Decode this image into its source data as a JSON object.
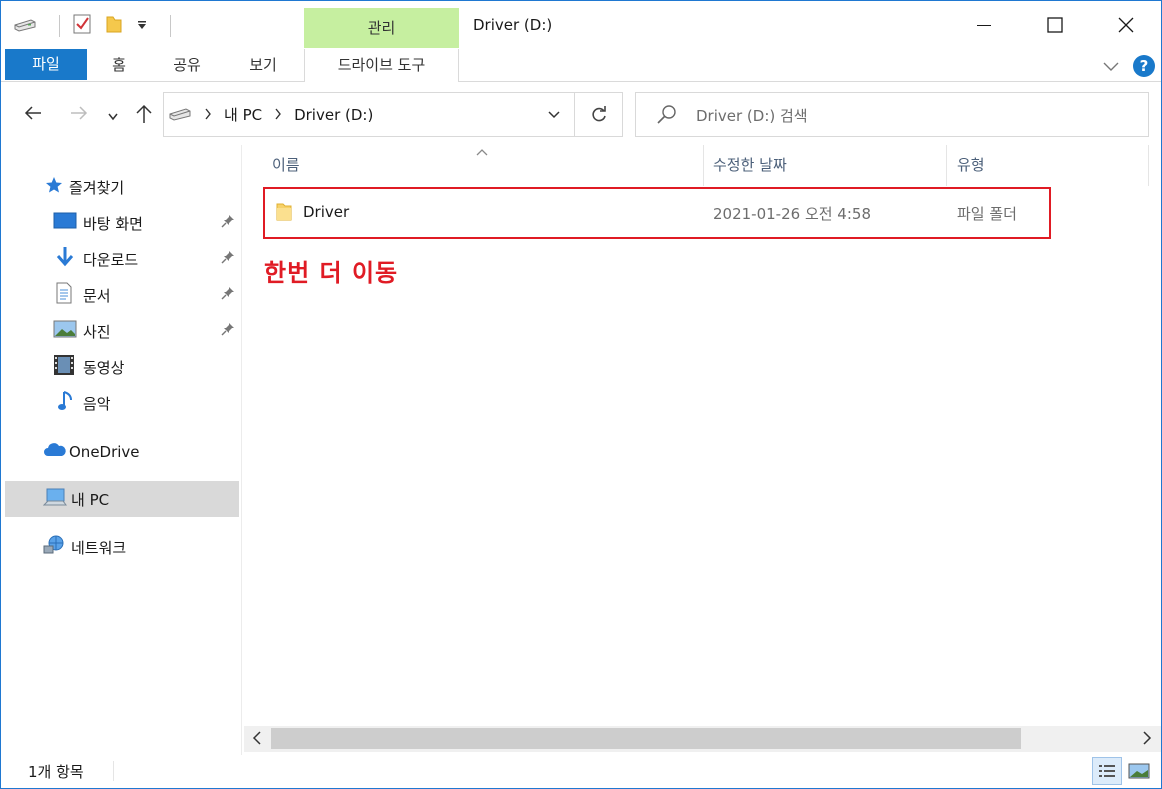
{
  "title": "Driver (D:)",
  "ribbon": {
    "contextual_label": "관리",
    "tabs": [
      "파일",
      "홈",
      "공유",
      "보기"
    ],
    "drive_tools": "드라이브 도구"
  },
  "address": {
    "crumbs": [
      "내 PC",
      "Driver (D:)"
    ]
  },
  "search": {
    "placeholder": "Driver (D:) 검색"
  },
  "sidebar": {
    "quick_access": "즐겨찾기",
    "items": [
      "바탕 화면",
      "다운로드",
      "문서",
      "사진",
      "동영상",
      "음악"
    ],
    "onedrive": "OneDrive",
    "this_pc": "내 PC",
    "network": "네트워크"
  },
  "columns": {
    "name": "이름",
    "date": "수정한 날짜",
    "type": "유형"
  },
  "files": [
    {
      "name": "Driver",
      "date": "2021-01-26 오전 4:58",
      "type": "파일 폴더"
    }
  ],
  "annotation": "한번 더 이동",
  "status": {
    "count": "1개 항목"
  },
  "colors": {
    "accent": "#1979ca",
    "contextual_tab": "#c6efa0",
    "annotation_red": "#e01b24",
    "selected_nav": "#d9d9d9"
  }
}
